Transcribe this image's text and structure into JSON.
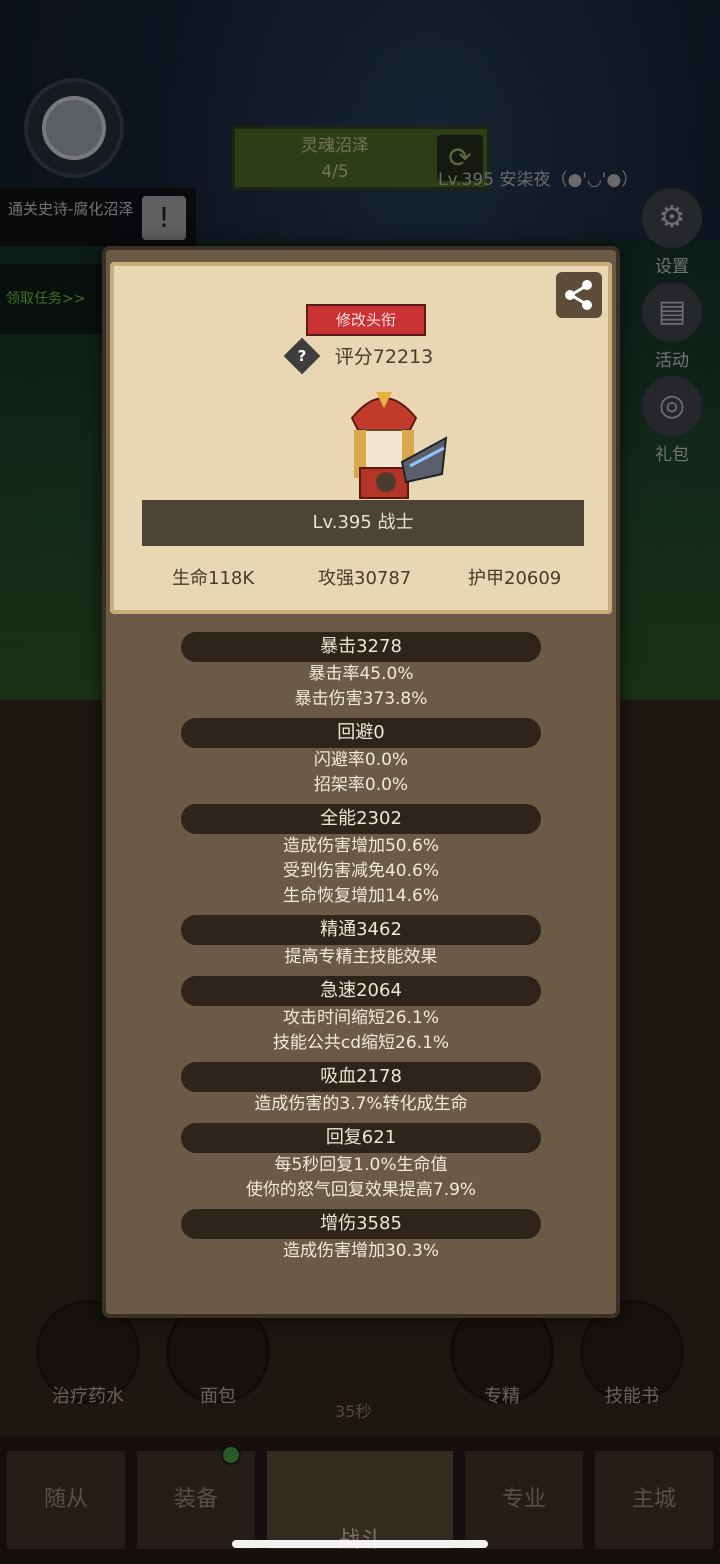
{
  "background": {
    "zone": {
      "name": "灵魂沼泽",
      "progress": "4/5"
    },
    "player_label": "Lv.395 安柒夜（●'◡'●）",
    "quest": {
      "title": "通关史诗-腐化沼泽",
      "link": "领取任务>>"
    },
    "side_buttons": [
      "设置",
      "活动",
      "礼包"
    ],
    "bottom_skills": [
      "治疗药水",
      "面包",
      "专精",
      "技能书"
    ],
    "timer": "35秒",
    "nav_tabs": [
      "随从",
      "装备",
      "战斗",
      "专业",
      "主城"
    ]
  },
  "card": {
    "rename_button": "修改头衔",
    "score": "评分72213",
    "level_class": "Lv.395 战士",
    "core_stats": [
      {
        "label": "生命118K"
      },
      {
        "label": "攻强30787"
      },
      {
        "label": "护甲20609"
      }
    ]
  },
  "stat_groups": [
    {
      "header": "暴击3278",
      "lines": [
        "暴击率45.0%",
        "暴击伤害373.8%"
      ]
    },
    {
      "header": "回避0",
      "lines": [
        "闪避率0.0%",
        "招架率0.0%"
      ]
    },
    {
      "header": "全能2302",
      "lines": [
        "造成伤害增加50.6%",
        "受到伤害减免40.6%",
        "生命恢复增加14.6%"
      ]
    },
    {
      "header": "精通3462",
      "lines": [
        "提高专精主技能效果"
      ]
    },
    {
      "header": "急速2064",
      "lines": [
        "攻击时间缩短26.1%",
        "技能公共cd缩短26.1%"
      ]
    },
    {
      "header": "吸血2178",
      "lines": [
        "造成伤害的3.7%转化成生命"
      ]
    },
    {
      "header": "回复621",
      "lines": [
        "每5秒回复1.0%生命值",
        "使你的怒气回复效果提高7.9%"
      ]
    },
    {
      "header": "增伤3585",
      "lines": [
        "造成伤害增加30.3%"
      ]
    }
  ]
}
